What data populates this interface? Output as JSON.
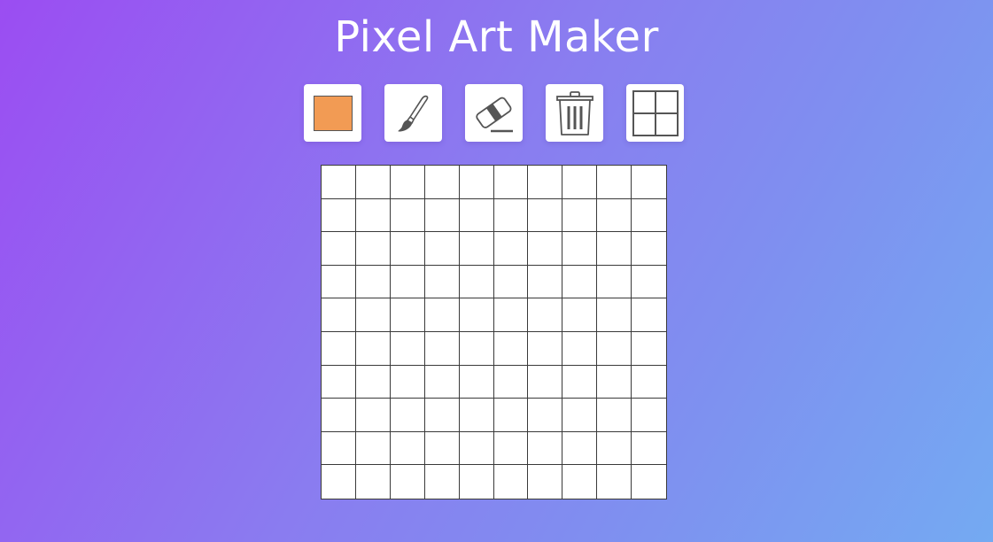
{
  "app": {
    "title": "Pixel Art Maker"
  },
  "toolbar": {
    "tools": [
      {
        "name": "color-picker",
        "icon": "color-swatch-icon",
        "color": "#f29b54"
      },
      {
        "name": "brush",
        "icon": "paintbrush-icon"
      },
      {
        "name": "eraser",
        "icon": "eraser-icon"
      },
      {
        "name": "clear",
        "icon": "trash-icon"
      },
      {
        "name": "grid-toggle",
        "icon": "grid-icon"
      }
    ]
  },
  "canvas": {
    "rows": 10,
    "columns": 10,
    "cell_color": "#ffffff",
    "line_color": "#3a3a3a"
  },
  "theme": {
    "gradient_start": "#9b4df2",
    "gradient_end": "#74aaf2",
    "title_color": "#ffffff"
  }
}
